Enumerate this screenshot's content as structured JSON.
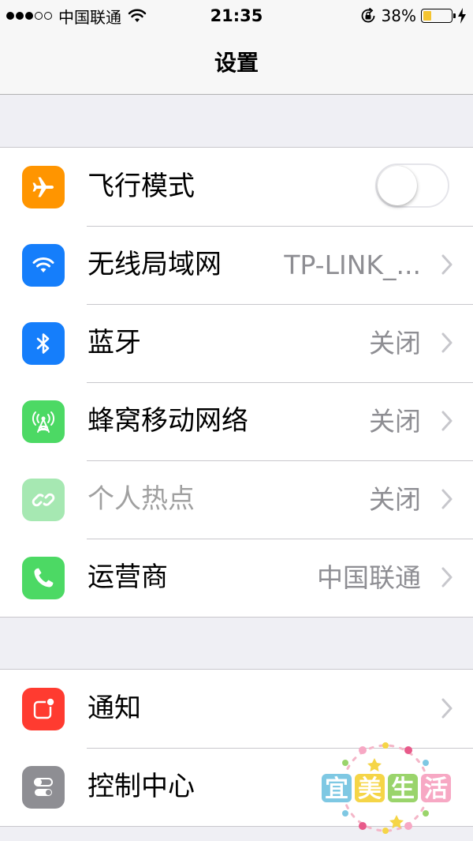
{
  "status_bar": {
    "carrier": "中国联通",
    "time": "21:35",
    "battery_percent": "38%",
    "battery_level": 0.38,
    "signal_bars_filled": 3,
    "signal_bars_total": 5,
    "battery_color": "#f4c430"
  },
  "nav": {
    "title": "设置"
  },
  "groups": [
    {
      "rows": [
        {
          "label": "飞行模式",
          "icon": "airplane-icon",
          "color": "#ff9500",
          "toggle": false
        },
        {
          "label": "无线局域网",
          "icon": "wifi-icon",
          "color": "#157efb",
          "value": "TP-LINK_..."
        },
        {
          "label": "蓝牙",
          "icon": "bluetooth-icon",
          "color": "#157efb",
          "value": "关闭"
        },
        {
          "label": "蜂窝移动网络",
          "icon": "cellular-icon",
          "color": "#4cd964",
          "value": "关闭"
        },
        {
          "label": "个人热点",
          "icon": "hotspot-icon",
          "color": "#a6e8b2",
          "value": "关闭",
          "disabled": true
        },
        {
          "label": "运营商",
          "icon": "phone-icon",
          "color": "#4cd964",
          "value": "中国联通"
        }
      ]
    },
    {
      "rows": [
        {
          "label": "通知",
          "icon": "notification-icon",
          "color": "#ff3b30"
        },
        {
          "label": "控制中心",
          "icon": "control-center-icon",
          "color": "#8e8e93"
        }
      ]
    }
  ],
  "watermark": {
    "text": "宜美生活"
  }
}
